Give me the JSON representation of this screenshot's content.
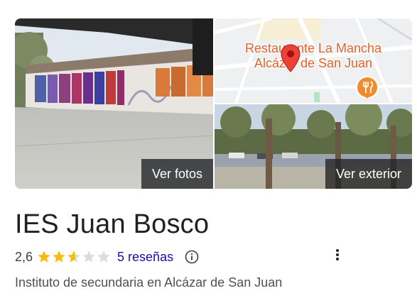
{
  "photos": {
    "view_photos_label": "Ver fotos",
    "view_exterior_label": "Ver exterior",
    "map": {
      "label_line1": "Restaurante La Mancha",
      "label_line2": "Alcázar de San Juan",
      "pin_icon": "map-pin-icon",
      "poi_icon": "restaurant-icon"
    }
  },
  "place": {
    "name": "IES Juan Bosco",
    "rating": "2,6",
    "rating_value": 2.6,
    "stars_max": 5,
    "reviews_label": "5 reseñas",
    "category": "Instituto de secundaria en Alcázar de San Juan"
  },
  "colors": {
    "star_filled": "#fbbc04",
    "star_empty": "#dadce0",
    "link": "#1a0dab",
    "map_label": "#e1632a",
    "pin": "#ea4335",
    "poi": "#f28b2a"
  },
  "icons": {
    "info": "info-icon",
    "more": "more-vert-icon"
  }
}
